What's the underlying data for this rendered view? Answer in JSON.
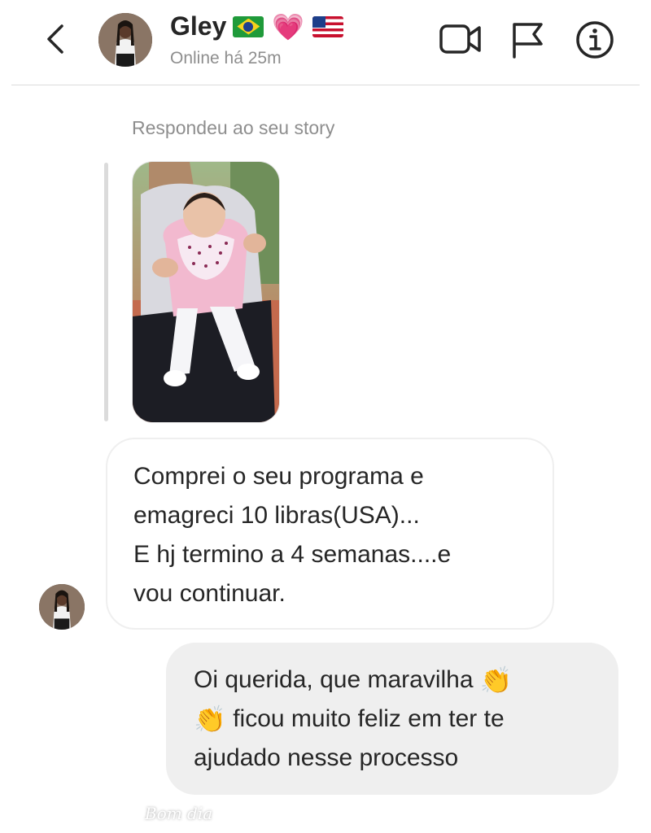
{
  "header": {
    "name": "Gley",
    "heart": "💗",
    "status": "Online há 25m"
  },
  "chat": {
    "story_caption": "Respondeu ao seu story",
    "story_overlay_text": "Bom dia",
    "incoming_lines": [
      "Comprei o seu programa e",
      "emagreci 10 libras(USA)...",
      "E hj termino a 4 semanas....e",
      "vou continuar."
    ],
    "outgoing": {
      "line1": "Oi querida, que maravilha",
      "line2": "ficou muito feliz em ter te",
      "line3": "ajudado nesse processo",
      "clap_emoji": "👏"
    }
  },
  "colors": {
    "secondary_text": "#8e8e8e",
    "outgoing_bubble": "#efefef",
    "divider": "#dbdbdb"
  },
  "icons": [
    "back-arrow-icon",
    "video-camera-icon",
    "flag-report-icon",
    "info-icon",
    "sun-icon"
  ]
}
